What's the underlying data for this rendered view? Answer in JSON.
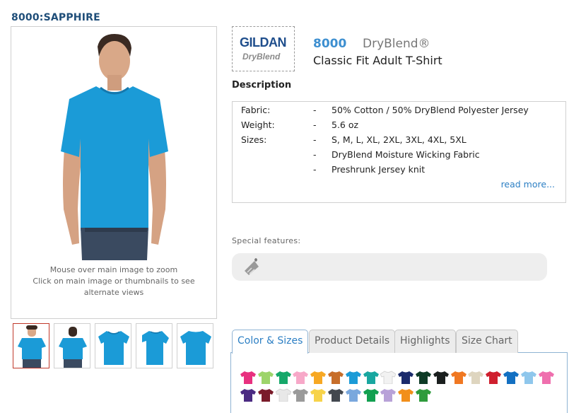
{
  "product": {
    "sku_color": "8000:SAPPHIRE",
    "style_number": "8000",
    "brand_line": "DryBlend®",
    "name": "Classic Fit Adult T-Shirt",
    "logo": {
      "line1": "GILDAN",
      "line2": "DryBlend"
    }
  },
  "main_image": {
    "shirt_color": "#1b9bd7",
    "hint": "Mouse over main image to zoom\nClick on main image or thumbnails to see alternate views"
  },
  "description": {
    "heading": "Description",
    "rows": [
      {
        "key": "Fabric:",
        "dash": "-",
        "value": "50% Cotton / 50% DryBlend Polyester Jersey"
      },
      {
        "key": "Weight:",
        "dash": "-",
        "value": "5.6 oz"
      },
      {
        "key": "Sizes:",
        "dash": "-",
        "value": "S, M, L, XL, 2XL, 3XL, 4XL, 5XL"
      },
      {
        "key": "",
        "dash": "-",
        "value": "DryBlend Moisture Wicking Fabric"
      },
      {
        "key": "",
        "dash": "-",
        "value": "Preshrunk Jersey knit"
      }
    ],
    "read_more": "read more..."
  },
  "special_features": {
    "label": "Special features:",
    "icon": "moisture-wicking-icon"
  },
  "tabs": [
    {
      "label": "Color & Sizes",
      "active": true
    },
    {
      "label": "Product Details",
      "active": false
    },
    {
      "label": "Highlights",
      "active": false
    },
    {
      "label": "Size Chart",
      "active": false
    }
  ],
  "color_swatches_row1": [
    "#e8307f",
    "#9dd46a",
    "#16a86a",
    "#f7a8c8",
    "#f7a823",
    "#c76e2a",
    "#1b9bd7",
    "#19a7a0",
    "#f2f2f2",
    "#1a2a6b",
    "#0e3b26",
    "#1a1f1e",
    "#f07822",
    "#ded5bf",
    "#cf1f2e",
    "#1370c2",
    "#8fc7ec",
    "#ef6fae"
  ],
  "color_swatches_row2": [
    "#4b2b82",
    "#7a1b2a",
    "#e8e8e8",
    "#9a9a9a",
    "#f7d34a",
    "#43484f",
    "#7aa8dd",
    "#12a050",
    "#b8a2d8",
    "#f28f1a",
    "#2e9b3c"
  ]
}
